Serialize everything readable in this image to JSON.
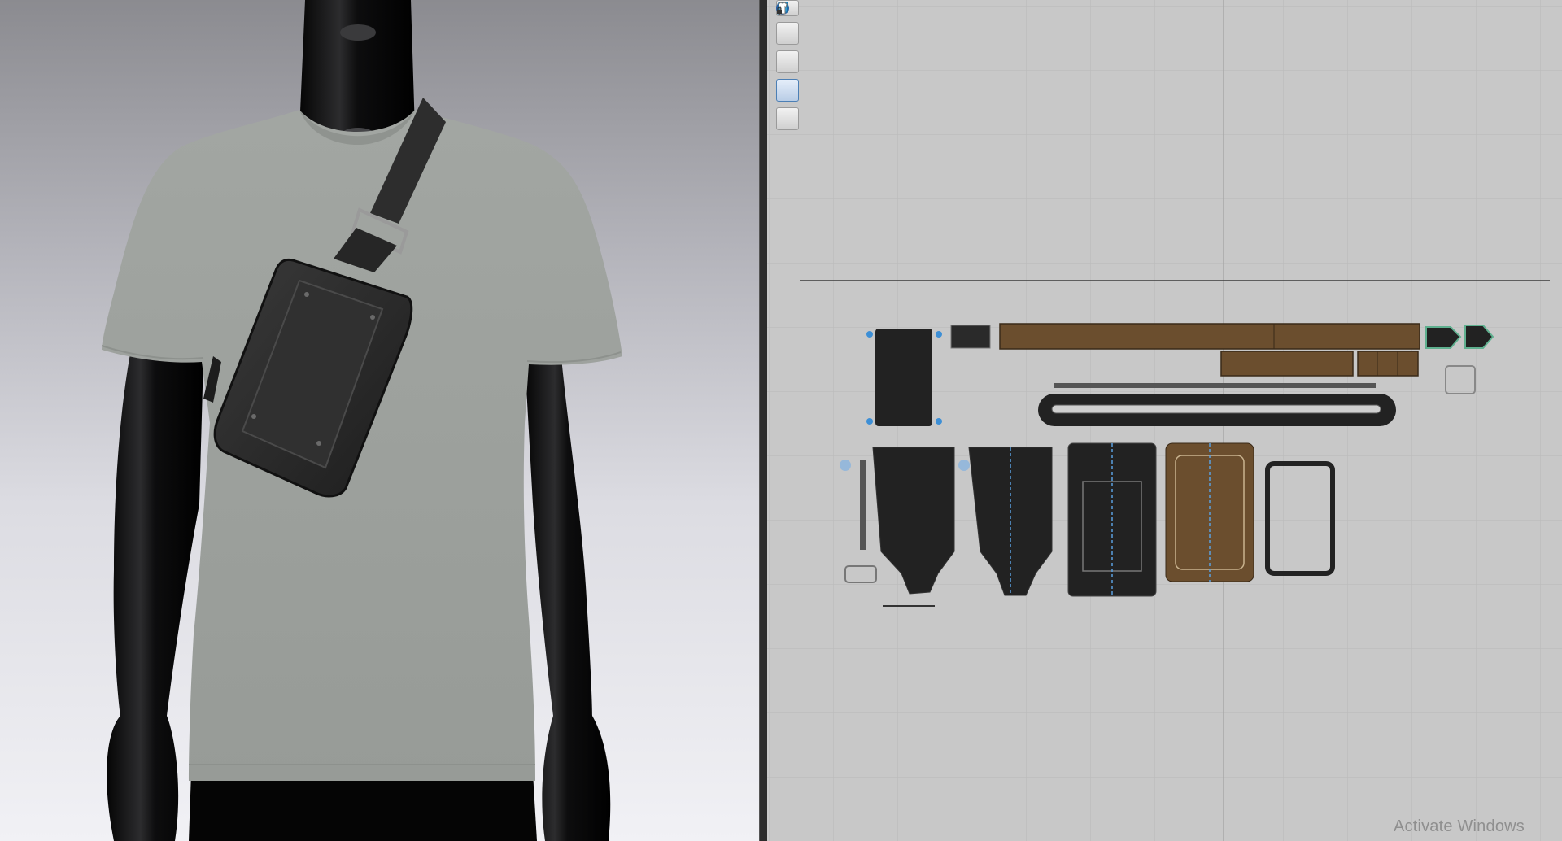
{
  "app": {
    "viewport_3d": {
      "background_top": "#8b8b90",
      "background_bottom": "#f1f1f5"
    },
    "viewport_2d": {
      "background": "#c8c8c8",
      "grid_color": "#b7b7b7"
    }
  },
  "toolbar_2d": {
    "tools": [
      {
        "icon": "pen-tool-icon"
      },
      {
        "icon": "show-avatar-garment-icon"
      },
      {
        "icon": "info-icon"
      },
      {
        "icon": "texture-view-icon"
      },
      {
        "icon": "lock-garment-icon"
      }
    ]
  },
  "colors": {
    "tshirt": "#9b9f9b",
    "mannequin": "#0b0b0c",
    "bag": "#2a2a2a",
    "leather_brown": "#6b4e2e",
    "pattern_black": "#222222",
    "selection_blue": "#3d8fd6"
  },
  "system": {
    "watermark": "Activate Windows"
  }
}
